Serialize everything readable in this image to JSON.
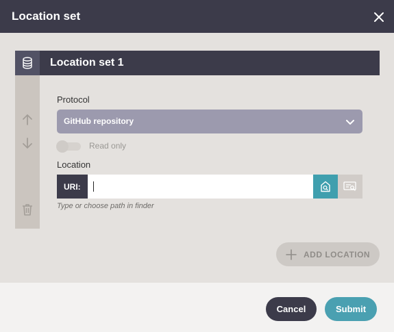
{
  "dialog": {
    "title": "Location set",
    "close_icon": "close-icon"
  },
  "location_set": {
    "title": "Location set 1",
    "header_icon": "database-icon",
    "side_icons": [
      "arrow-up-icon",
      "arrow-down-icon",
      "trash-icon"
    ],
    "protocol": {
      "label": "Protocol",
      "selected": "GitHub repository",
      "chevron_icon": "chevron-down-icon"
    },
    "read_only": {
      "label": "Read only",
      "checked": false
    },
    "location": {
      "label": "Location",
      "prefix": "URI:",
      "value": "",
      "hint": "Type or choose path in finder",
      "finder_icon": "finder-icon",
      "browse_icon": "browse-icon"
    }
  },
  "actions": {
    "add_location": "ADD LOCATION",
    "add_icon": "plus-icon",
    "cancel": "Cancel",
    "submit": "Submit"
  },
  "colors": {
    "header_dark": "#3c3b4a",
    "select_bg": "#9c9aae",
    "accent_teal": "#4aa0b1",
    "panel_bg": "#e4e1de"
  }
}
